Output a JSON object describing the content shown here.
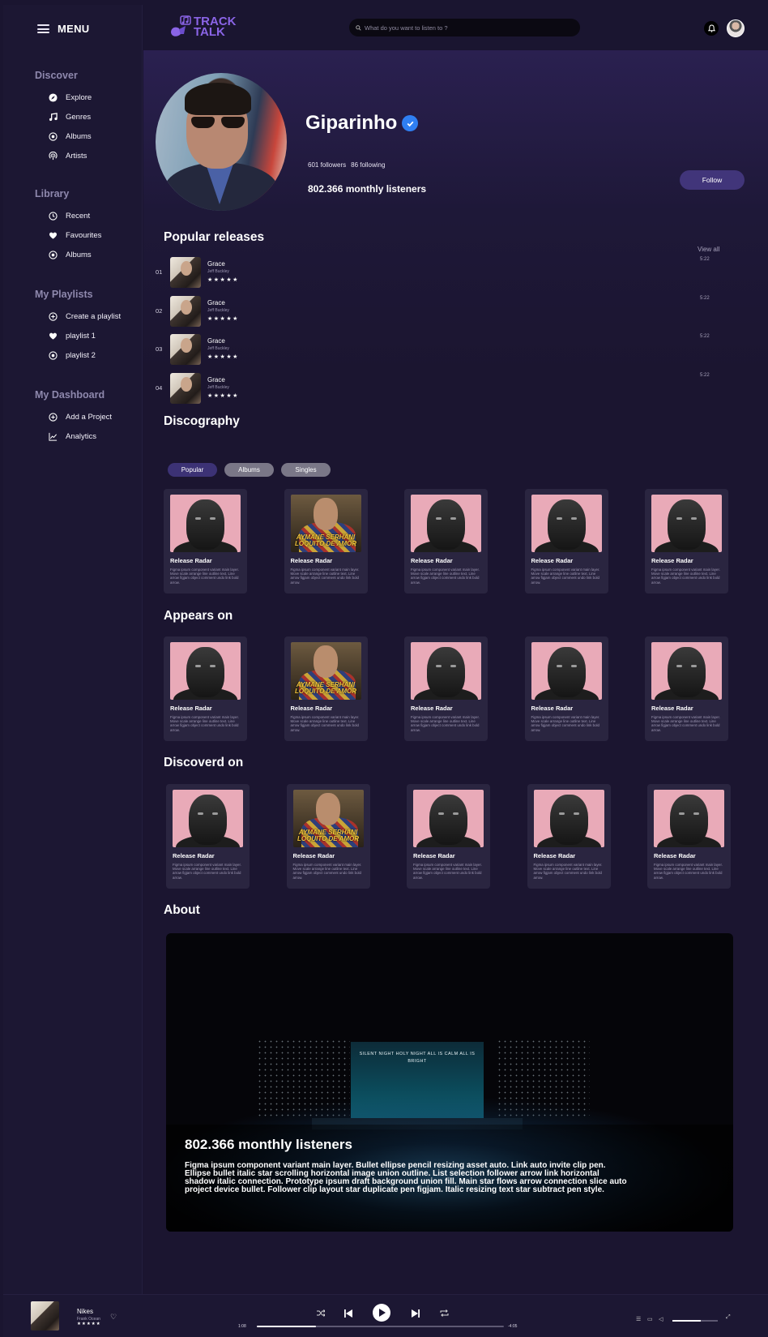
{
  "sidebar": {
    "menu_label": "MENU",
    "sections": [
      {
        "title": "Discover",
        "items": [
          {
            "label": "Explore",
            "icon": "compass-icon"
          },
          {
            "label": "Genres",
            "icon": "music-note-icon"
          },
          {
            "label": "Albums",
            "icon": "disc-icon"
          },
          {
            "label": "Artists",
            "icon": "podcast-icon"
          }
        ]
      },
      {
        "title": "Library",
        "items": [
          {
            "label": "Recent",
            "icon": "clock-icon"
          },
          {
            "label": "Favourites",
            "icon": "heart-icon"
          },
          {
            "label": "Albums",
            "icon": "disc-icon"
          }
        ]
      },
      {
        "title": "My Playlists",
        "items": [
          {
            "label": "Create a playlist",
            "icon": "plus-circle-icon"
          },
          {
            "label": "playlist 1",
            "icon": "heart-icon"
          },
          {
            "label": "playlist 2",
            "icon": "disc-icon"
          }
        ]
      },
      {
        "title": "My Dashboard",
        "items": [
          {
            "label": "Add a Project",
            "icon": "plus-circle-icon"
          },
          {
            "label": "Analytics",
            "icon": "chart-line-icon"
          }
        ]
      }
    ]
  },
  "header": {
    "logo_line1": "TRACK",
    "logo_line2": "TALK",
    "search_placeholder": "What do you want to listen to ?"
  },
  "profile": {
    "name": "Giparinho",
    "followers": "601 followers",
    "following": "86 following",
    "monthly_listeners": "802.366 monthly listeners",
    "follow_label": "Follow"
  },
  "popular": {
    "title": "Popular releases",
    "view_all": "View all",
    "tracks": [
      {
        "num": "01",
        "title": "Grace",
        "artist": "Jeff Buckley",
        "stars": "★★★★★",
        "duration": "5:22"
      },
      {
        "num": "02",
        "title": "Grace",
        "artist": "Jeff Buckley",
        "stars": "★★★★★",
        "duration": "5:22"
      },
      {
        "num": "03",
        "title": "Grace",
        "artist": "Jeff Buckley",
        "stars": "★★★★★",
        "duration": "5:22"
      },
      {
        "num": "04",
        "title": "Grace",
        "artist": "Jeff Buckley",
        "stars": "★★★★★",
        "duration": "5:22"
      }
    ]
  },
  "discography": {
    "title": "Discography",
    "filters": [
      "Popular",
      "Albums",
      "Singles"
    ],
    "cards": [
      {
        "title": "Release Radar",
        "desc": "Figma ipsum component variant main layer. Move scale arrange line outline text. Line arrow figjam object comment undo link bold arrow."
      },
      {
        "title": "Release Radar",
        "desc": "Figma ipsum component variant main layer. Move scale arrange line outline text. Line arrow figjam object comment undo link bold arrow."
      },
      {
        "title": "Release Radar",
        "desc": "Figma ipsum component variant main layer. Move scale arrange line outline text. Line arrow figjam object comment undo link bold arrow."
      },
      {
        "title": "Release Radar",
        "desc": "Figma ipsum component variant main layer. Move scale arrange line outline text. Line arrow figjam object comment undo link bold arrow."
      },
      {
        "title": "Release Radar",
        "desc": "Figma ipsum component variant main layer. Move scale arrange line outline text. Line arrow figjam object comment undo link bold arrow."
      }
    ]
  },
  "appears_on": {
    "title": "Appears on",
    "cards": [
      {
        "title": "Release Radar",
        "desc": "Figma ipsum component variant main layer. Move scale arrange line outline text. Line arrow figjam object comment undo link bold arrow."
      },
      {
        "title": "Release Radar",
        "desc": "Figma ipsum component variant main layer. Move scale arrange line outline text. Line arrow figjam object comment undo link bold arrow."
      },
      {
        "title": "Release Radar",
        "desc": "Figma ipsum component variant main layer. Move scale arrange line outline text. Line arrow figjam object comment undo link bold arrow."
      },
      {
        "title": "Release Radar",
        "desc": "Figma ipsum component variant main layer. Move scale arrange line outline text. Line arrow figjam object comment undo link bold arrow."
      },
      {
        "title": "Release Radar",
        "desc": "Figma ipsum component variant main layer. Move scale arrange line outline text. Line arrow figjam object comment undo link bold arrow."
      }
    ]
  },
  "discovered_on": {
    "title": "Discoverd on",
    "cards": [
      {
        "title": "Release Radar",
        "desc": "Figma ipsum component variant main layer. Move scale arrange line outline text. Line arrow figjam object comment undo link bold arrow."
      },
      {
        "title": "Release Radar",
        "desc": "Figma ipsum component variant main layer. Move scale arrange line outline text. Line arrow figjam object comment undo link bold arrow."
      },
      {
        "title": "Release Radar",
        "desc": "Figma ipsum component variant main layer. Move scale arrange line outline text. Line arrow figjam object comment undo link bold arrow."
      },
      {
        "title": "Release Radar",
        "desc": "Figma ipsum component variant main layer. Move scale arrange line outline text. Line arrow figjam object comment undo link bold arrow."
      },
      {
        "title": "Release Radar",
        "desc": "Figma ipsum component variant main layer. Move scale arrange line outline text. Line arrow figjam object comment undo link bold arrow."
      }
    ]
  },
  "alt_cover_text": "AYMANE SERHANI LOQUITO DE AMOR",
  "about": {
    "title": "About",
    "screen_text": "SILENT NIGHT HOLY NIGHT ALL IS CALM ALL IS BRIGHT",
    "listeners": "802.366 monthly listeners",
    "desc": "Figma ipsum component variant main layer. Bullet ellipse pencil resizing asset auto. Link auto invite clip pen. Ellipse bullet italic star scrolling horizontal image union outline. List selection follower arrow link horizontal shadow italic connection. Prototype ipsum draft background union fill. Main star flows arrow connection slice auto project device bullet. Follower clip layout star duplicate pen figjam. Italic resizing text star subtract pen style."
  },
  "player": {
    "title": "Nikes",
    "artist": "Frank Ocean",
    "stars": "★★★★★",
    "elapsed": "1:08",
    "remaining": "-4:05",
    "progress_percent": 24,
    "volume_percent": 62
  },
  "colors": {
    "accent": "#8a64e6",
    "verified": "#2f7ff2",
    "background": "#1a1530",
    "card": "#2a2540"
  }
}
